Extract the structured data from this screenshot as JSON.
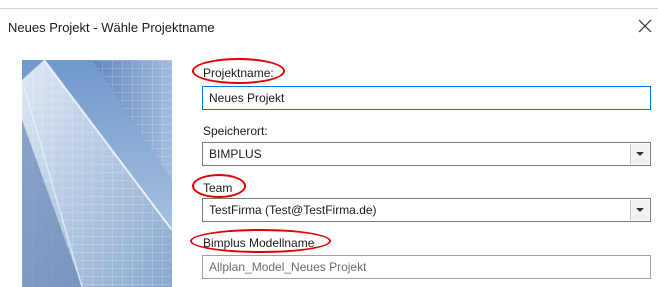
{
  "window": {
    "title": "Neues Projekt - Wähle Projektname",
    "close_icon": "close-icon"
  },
  "form": {
    "project_name": {
      "label": "Projektname:",
      "value": "Neues Projekt"
    },
    "storage": {
      "label": "Speicherort:",
      "value": "BIMPLUS"
    },
    "team": {
      "label": "Team",
      "value": "TestFirma (Test@TestFirma.de)"
    },
    "model_name": {
      "label": "Bimplus Modellname",
      "value": "Allplan_Model_Neues Projekt"
    }
  },
  "annotations": {
    "highlight_color": "#e00000"
  },
  "colors": {
    "focus_border": "#0078d7",
    "sky": "#7fa6d6"
  }
}
